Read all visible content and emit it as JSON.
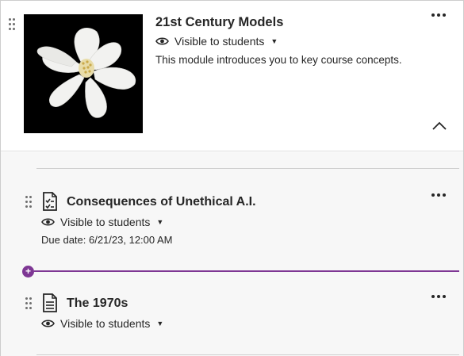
{
  "module": {
    "title": "21st Century Models",
    "visibility": "Visible to students",
    "description": "This module introduces you to key course concepts."
  },
  "items": [
    {
      "title": "Consequences of Unethical A.I.",
      "type_icon": "assignment-icon",
      "visibility": "Visible to students",
      "due_date": "Due date: 6/21/23, 12:00 AM"
    },
    {
      "title": "The 1970s",
      "type_icon": "document-icon",
      "visibility": "Visible to students"
    }
  ],
  "colors": {
    "accent_purple": "#7e3794",
    "text": "#262626",
    "content_bg": "#f7f7f7"
  }
}
